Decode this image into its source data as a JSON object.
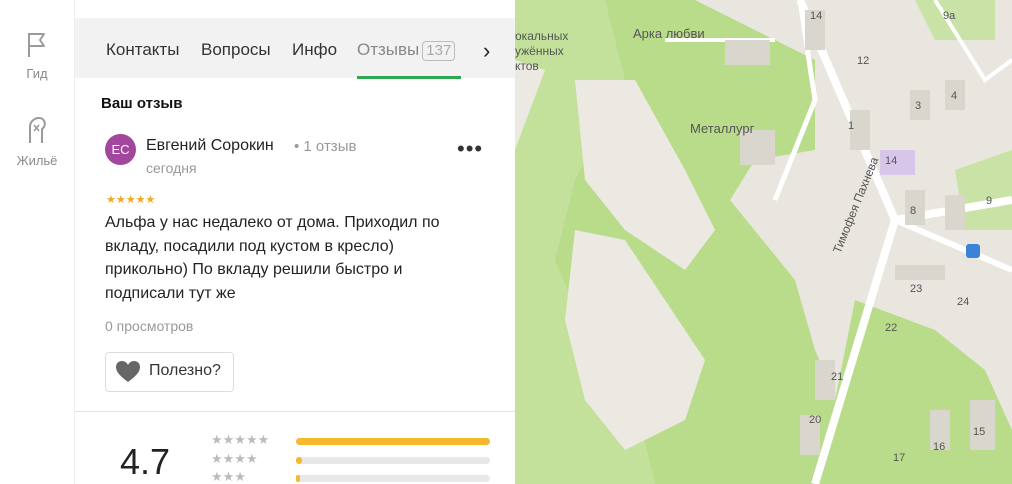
{
  "rail": {
    "items": [
      {
        "label": "Гид",
        "icon": "flag-icon"
      },
      {
        "label": "Жильё",
        "icon": "building-icon"
      }
    ]
  },
  "tabs": {
    "items": [
      "Контакты",
      "Вопросы",
      "Инфо",
      "Отзывы"
    ],
    "reviews_count": "137",
    "active": "Отзывы"
  },
  "review": {
    "section_title": "Ваш отзыв",
    "avatar_initials": "ЕС",
    "author": "Евгений Сорокин",
    "author_meta": "• 1 отзыв",
    "date": "сегодня",
    "stars": "★★★★★",
    "rating": 5,
    "text": "Альфа у нас недалеко от дома. Приходил по вкладу, посадили под кустом в кресло) прикольно) По вкладу решили быстро и подписали тут же",
    "views": "0 просмотров",
    "useful_label": "Полезно?"
  },
  "summary": {
    "rating": "4.7",
    "distribution": [
      {
        "stars": "★★★★★",
        "fraction": 1.0
      },
      {
        "stars": "★★★★",
        "fraction": 0.03
      },
      {
        "stars": "★★★",
        "fraction": 0.02
      }
    ]
  },
  "map": {
    "labels": [
      "Арка любви",
      "Металлург",
      "Тимофея Пахнева",
      "окальных",
      "ужённых",
      "ктов",
      "14",
      "9а",
      "12",
      "3",
      "4",
      "1",
      "14",
      "8",
      "9",
      "23",
      "24",
      "22",
      "21",
      "20",
      "16",
      "15",
      "17"
    ],
    "colors": {
      "park": "#b9dc8a",
      "land": "#e9e6df",
      "road": "#ffffff",
      "building": "#d9d6cd",
      "accent": "#2fa84f",
      "star": "#f5a623",
      "bar": "#f5b82e",
      "avatar": "#a3469d"
    }
  }
}
